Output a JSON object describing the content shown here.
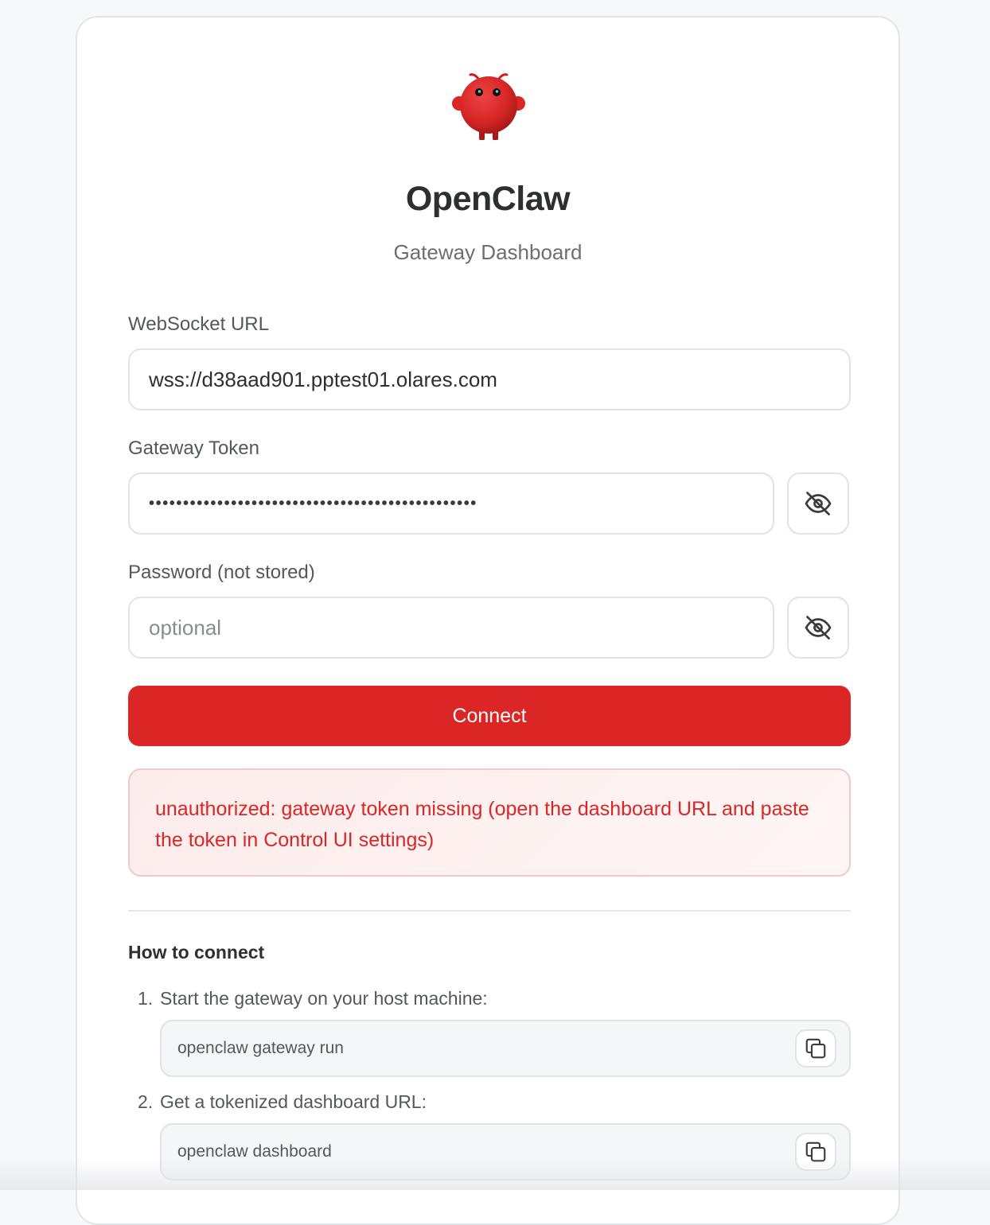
{
  "app": {
    "title": "OpenClaw",
    "subtitle": "Gateway Dashboard"
  },
  "form": {
    "url_label": "WebSocket URL",
    "url_value": "wss://d38aad901.pptest01.olares.com",
    "token_label": "Gateway Token",
    "token_masked": "••••••••••••••••••••••••••••••••••••••••••••••••",
    "password_label": "Password (not stored)",
    "password_placeholder": "optional",
    "connect_label": "Connect"
  },
  "error": {
    "message": "unauthorized: gateway token missing (open the dashboard URL and paste the token in Control UI settings)"
  },
  "help": {
    "title": "How to connect",
    "steps": [
      {
        "num": "1.",
        "text": "Start the gateway on your host machine:",
        "command": "openclaw gateway run"
      },
      {
        "num": "2.",
        "text": "Get a tokenized dashboard URL:",
        "command": "openclaw dashboard"
      }
    ]
  },
  "icons": {
    "logo": "crab-mascot-logo",
    "visibility": "eye-off-icon",
    "copy": "copy-icon"
  },
  "colors": {
    "accent": "#dc2626",
    "error_text": "#dc2626",
    "error_bg": "#fdecec"
  }
}
